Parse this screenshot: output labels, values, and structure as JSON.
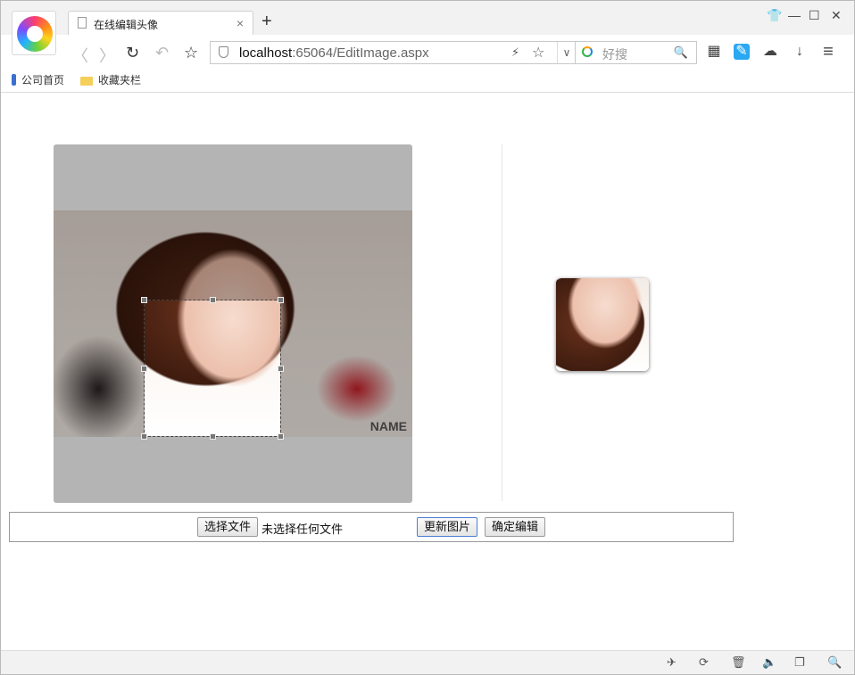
{
  "browser": {
    "tab": {
      "title": "在线编辑头像",
      "close": "×"
    },
    "new_tab": "+",
    "window_controls": {
      "skin": "👕",
      "minimize": "—",
      "maximize": "☐",
      "close": "✕"
    },
    "nav": {
      "back": "〈",
      "forward": "〉",
      "reload": "↻",
      "undo": "↶",
      "favorite": "☆"
    },
    "address": {
      "host": "localhost",
      "rest": ":65064/EditImage.aspx",
      "bolt": "⚡",
      "star": "☆",
      "dropdown": "∨"
    },
    "search": {
      "placeholder": "好搜",
      "icon": "🔍"
    },
    "toolbar_icons": {
      "apps": "▦",
      "notes": "✎",
      "cloud": "☁",
      "download": "↓",
      "menu": "≡"
    },
    "bookmarks": [
      {
        "label": "公司首页",
        "icon": "bookmark-icon"
      },
      {
        "label": "收藏夹栏",
        "icon": "folder-icon"
      }
    ],
    "status_icons": {
      "pin": "✈",
      "speed": "⟳",
      "trash": "🗑",
      "sound": "🔈",
      "window": "❐",
      "zoom": "🔍"
    }
  },
  "editor": {
    "photo_watermark": "NAME",
    "form": {
      "choose_file": "选择文件",
      "no_file": "未选择任何文件",
      "update_image": "更新图片",
      "confirm_edit": "确定编辑"
    }
  },
  "colors": {
    "stage_bg": "#b4b4b4",
    "accent": "#4a7fd6"
  }
}
